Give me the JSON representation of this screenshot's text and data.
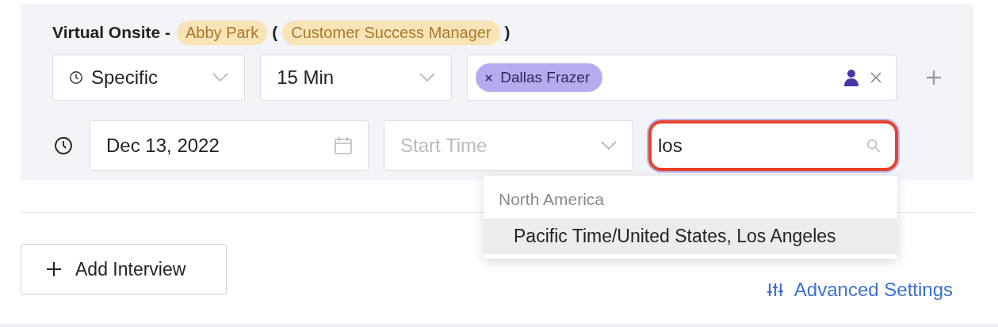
{
  "heading": {
    "title": "Virtual Onsite -",
    "candidate": "Abby Park",
    "open_paren": "(",
    "role": "Customer Success Manager",
    "close_paren": ")"
  },
  "schedule_type": {
    "value": "Specific"
  },
  "duration": {
    "value": "15 Min"
  },
  "interviewers": [
    {
      "name": "Dallas Frazer"
    }
  ],
  "date": {
    "value": "Dec 13, 2022"
  },
  "start_time": {
    "placeholder": "Start Time"
  },
  "timezone": {
    "value": "los",
    "focused": true
  },
  "timezone_menu": {
    "groups": [
      {
        "label": "North America",
        "options": [
          {
            "label": "Pacific Time/United States, Los Angeles",
            "selected": true
          }
        ]
      }
    ]
  },
  "add_interview": {
    "label": "Add Interview"
  },
  "advanced_settings": {
    "label": "Advanced Settings"
  }
}
